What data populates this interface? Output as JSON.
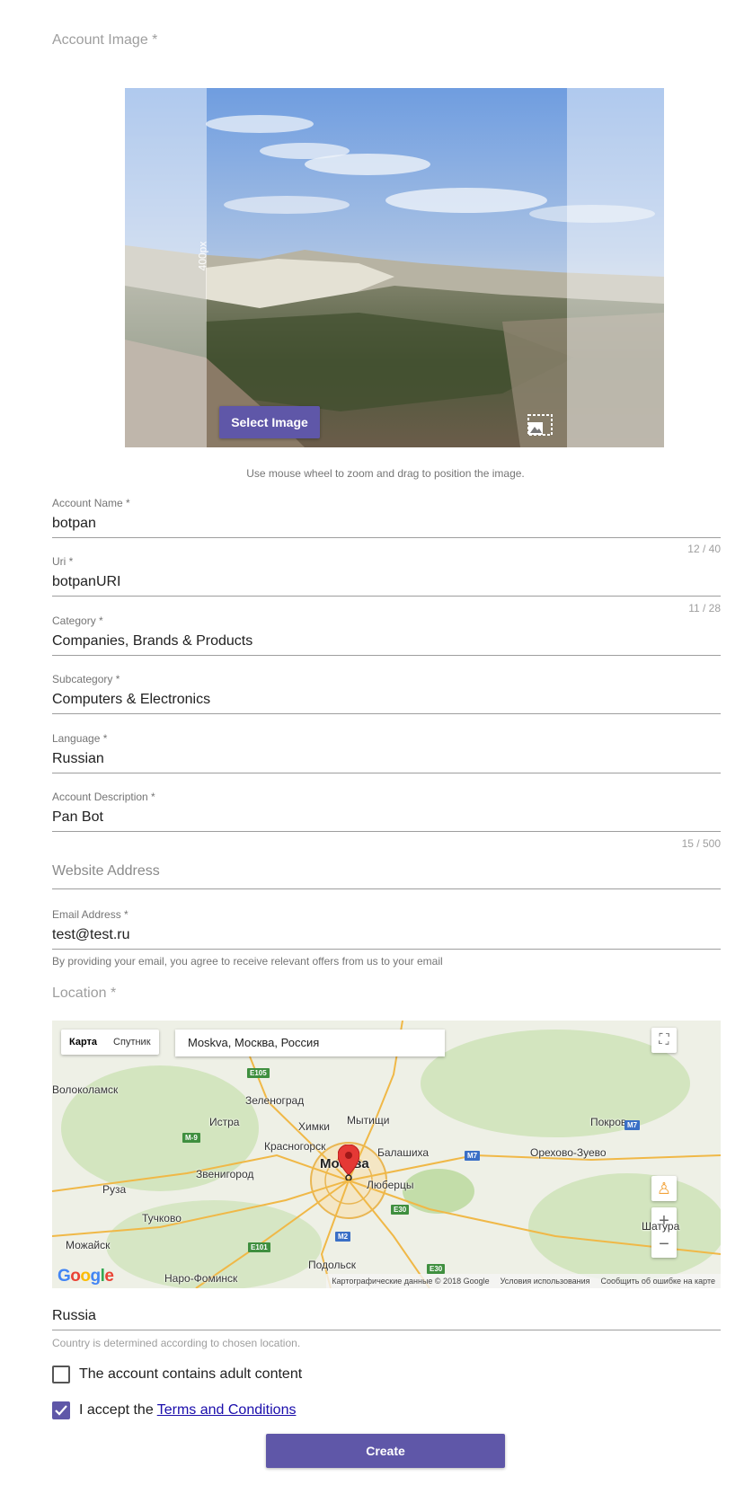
{
  "account_image": {
    "label": "Account Image *",
    "crop_size": "400px",
    "select_label": "Select Image",
    "hint": "Use mouse wheel to zoom and drag to position the image."
  },
  "fields": {
    "account_name": {
      "label": "Account Name *",
      "value": "botpan",
      "counter": "12 / 40"
    },
    "uri": {
      "label": "Uri *",
      "value": "botpanURI",
      "counter": "11 / 28"
    },
    "category": {
      "label": "Category *",
      "value": "Companies, Brands & Products"
    },
    "subcategory": {
      "label": "Subcategory *",
      "value": "Computers & Electronics"
    },
    "language": {
      "label": "Language *",
      "value": "Russian"
    },
    "description": {
      "label": "Account Description *",
      "value": "Pan Bot",
      "counter": "15 / 500"
    },
    "website": {
      "placeholder": "Website Address"
    },
    "email": {
      "label": "Email Address *",
      "value": "test@test.ru",
      "helper": "By providing your email, you agree to receive relevant offers from us to your email"
    }
  },
  "location": {
    "label": "Location *",
    "map": {
      "type_map": "Карта",
      "type_satellite": "Спутник",
      "search_value": "Moskva, Москва, Россия",
      "cities": [
        "Волоколамск",
        "Зеленоград",
        "Истра",
        "Химки",
        "Мытищи",
        "Красногорск",
        "Москва",
        "Балашиха",
        "Покров",
        "Орехово-Зуево",
        "Звенигород",
        "Люберцы",
        "Руза",
        "Тучково",
        "Шатура",
        "Можайск",
        "Наро-Фоминск",
        "Подольск"
      ],
      "roads": [
        "E105",
        "M-9",
        "M7",
        "M7",
        "E30",
        "M2",
        "E101",
        "E30"
      ],
      "footer": [
        "Картографические данные © 2018 Google",
        "Условия использования",
        "Сообщить об ошибке на карте"
      ],
      "logo": "Google"
    },
    "country_value": "Russia",
    "country_helper": "Country is determined according to chosen location."
  },
  "checkboxes": {
    "adult_label": "The account contains adult content",
    "adult_checked": false,
    "terms_prefix": "I accept the",
    "terms_link": "Terms and Conditions",
    "terms_checked": true
  },
  "create_label": "Create",
  "colors": {
    "accent": "#5f57a8",
    "link": "#1a0dab"
  }
}
